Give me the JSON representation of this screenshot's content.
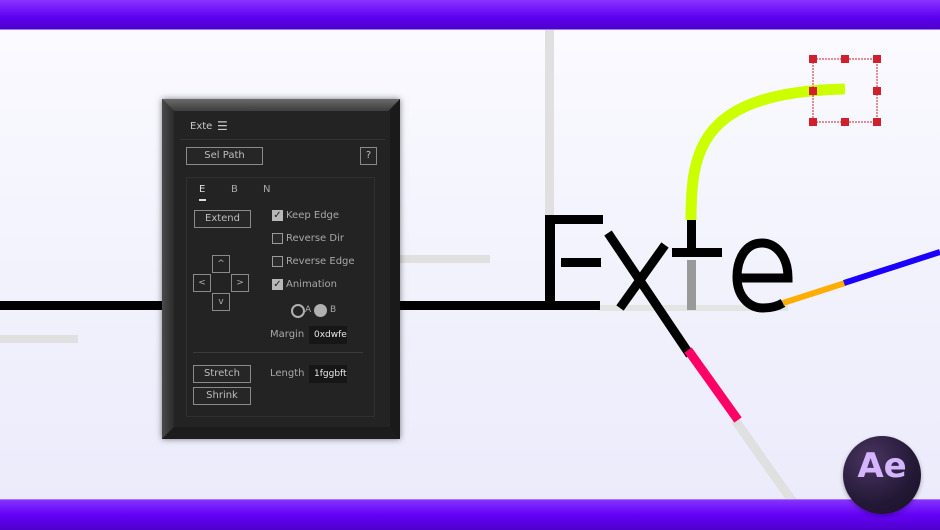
{
  "banner": {
    "top_color": "#6a00ff",
    "bottom_color": "#6a00ff"
  },
  "scene": {
    "word": "Exte",
    "colors": {
      "lime": "#ccff00",
      "orange": "#ffae00",
      "blue": "#1a00ff",
      "pink": "#ff0066",
      "guide": "#e0e0e0",
      "handle": "#d0202d",
      "stroke": "#000000"
    }
  },
  "panel": {
    "title": "Exte",
    "menu_icon": "hamburger-icon",
    "sel_path_label": "Sel Path",
    "help_label": "?",
    "tabs": [
      {
        "label": "E",
        "active": true
      },
      {
        "label": "B",
        "active": false
      },
      {
        "label": "N",
        "active": false
      }
    ],
    "extend_label": "Extend",
    "arrows": {
      "up": "^",
      "left": "<",
      "right": ">",
      "down": "v"
    },
    "checkboxes": [
      {
        "label": "Keep Edge",
        "checked": true
      },
      {
        "label": "Reverse Dir",
        "checked": false
      },
      {
        "label": "Reverse Edge",
        "checked": false
      },
      {
        "label": "Animation",
        "checked": true
      }
    ],
    "radios": [
      {
        "label": "A",
        "selected": false
      },
      {
        "label": "B",
        "selected": true
      }
    ],
    "margin_label": "Margin",
    "margin_value": "0xdwfe",
    "stretch_label": "Stretch",
    "shrink_label": "Shrink",
    "length_label": "Length",
    "length_value": "1fggbft"
  },
  "logo": {
    "text": "Ae"
  }
}
